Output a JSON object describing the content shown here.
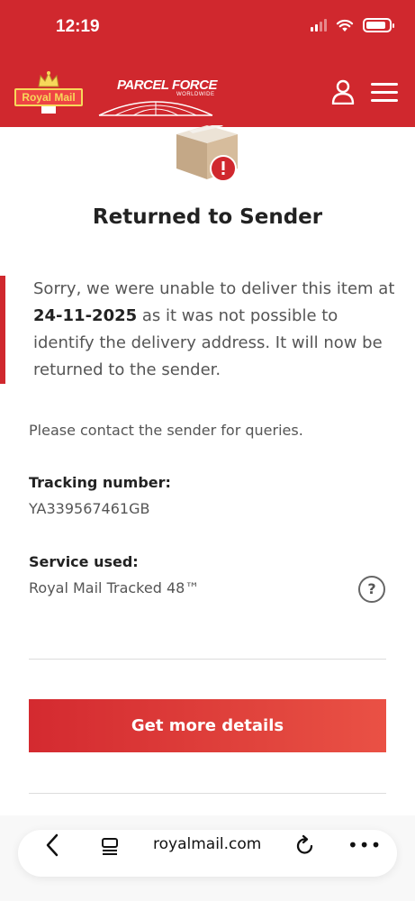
{
  "status_bar": {
    "time": "12:19"
  },
  "header": {
    "royal_mail_logo_text": "Royal Mail",
    "parcelforce_logo_text": "PARCEL FORCE",
    "parcelforce_sub": "WORLDWIDE",
    "user_icon": "user-icon",
    "menu_icon": "menu-icon",
    "brand_color": "#d0282e"
  },
  "content": {
    "title": "Returned to Sender",
    "message_before": "Sorry, we were unable to deliver this item at ",
    "date": "24-11-2025",
    "message_after": " as it was not possible to identify the delivery address. It will now be returned to the sender.",
    "contact_note": "Please contact the sender for queries.",
    "tracking_label": "Tracking number:",
    "tracking_value": "YA339567461GB",
    "service_label": "Service used:",
    "service_value": "Royal Mail Tracked 48™",
    "help_symbol": "?",
    "button_label": "Get more details"
  },
  "browser": {
    "url": "royalmail.com",
    "more_symbol": "•••"
  }
}
